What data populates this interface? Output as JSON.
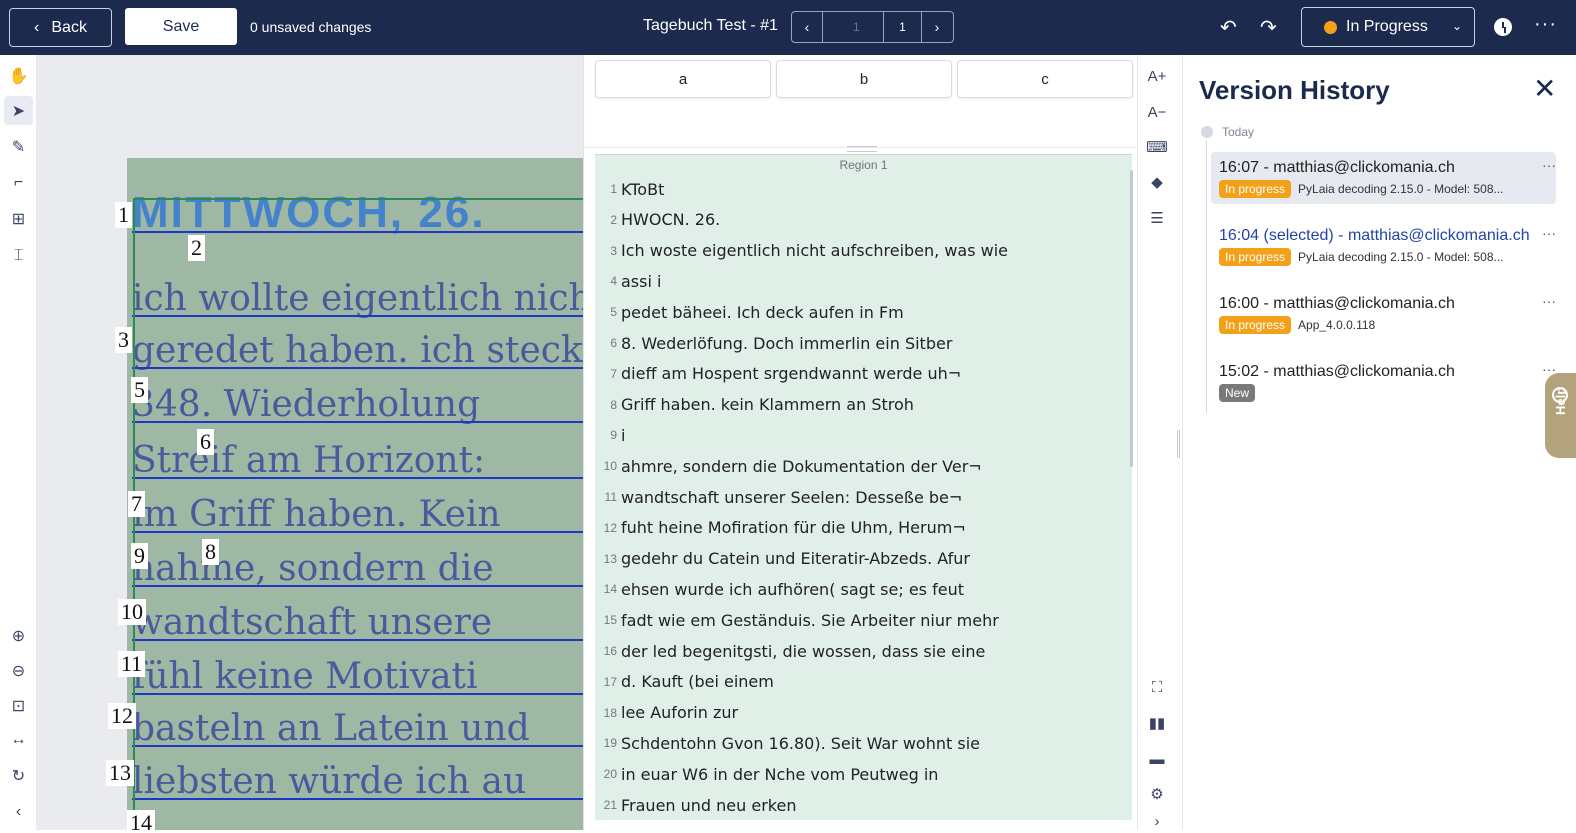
{
  "topbar": {
    "back_label": "Back",
    "save_label": "Save",
    "unsaved": "0 unsaved changes",
    "title": "Tagebuch Test - #1",
    "page_input_placeholder": "1",
    "page_total": "1",
    "status": "In Progress",
    "status_color": "#f4a11a"
  },
  "left_toolbar": {
    "tools": [
      "pan-tool",
      "select-tool",
      "draw-tool",
      "crop-tool",
      "layout-tool",
      "region-tool",
      "zoom-in",
      "zoom-out",
      "fit-screen",
      "fit-width",
      "rotate",
      "collapse"
    ]
  },
  "image": {
    "handwriting": [
      "MITTWOCH, 26.",
      "ich wollte eigentlich nicht",
      "geredet haben. ich steck",
      "348. Wiederholung",
      "Streif am Horizont:",
      "im Griff haben. Kein",
      "nahme, sondern die",
      "wandtschaft unsere",
      "fühl keine Motivati",
      "basteln an Latein und",
      "liebsten würde ich au"
    ],
    "line_numbers": [
      "1",
      "2",
      "3",
      "5",
      "6",
      "7",
      "9",
      "8",
      "10",
      "11",
      "12",
      "13",
      "14"
    ]
  },
  "transcription": {
    "keyboard_keys": [
      "a",
      "b",
      "c"
    ],
    "region_label": "Region 1",
    "lines": [
      {
        "n": "1",
        "text": "KToBt"
      },
      {
        "n": "2",
        "text": "HWOCN. 26."
      },
      {
        "n": "3",
        "text": "Ich woste eigentlich nicht aufschreiben, was wie"
      },
      {
        "n": "4",
        "text": "assi i"
      },
      {
        "n": "5",
        "text": "pedet bäheei. Ich deck aufen in Fm"
      },
      {
        "n": "6",
        "text": "8. Wederlöfung. Doch immerlin ein Sitber"
      },
      {
        "n": "7",
        "text": "dieff am Hospent srgendwannt werde uh¬"
      },
      {
        "n": "8",
        "text": "Griff haben. kein Klammern an Stroh"
      },
      {
        "n": "9",
        "text": "i"
      },
      {
        "n": "10",
        "text": "ahmre, sondern die Dokumentation der Ver¬"
      },
      {
        "n": "11",
        "text": "wandtschaft unserer Seelen: Desseße be¬"
      },
      {
        "n": "12",
        "text": "fuht heine Mofiration für die Uhm, Herum¬"
      },
      {
        "n": "13",
        "text": "gedehr du Catein und Eiteratir-Abzeds. Afur"
      },
      {
        "n": "14",
        "text": "ehsen wurde ich aufhören( sagt se; es feut"
      },
      {
        "n": "15",
        "text": "fadt wie em Geständuis. Sie Arbeiter niur mehr"
      },
      {
        "n": "16",
        "text": "der led begenitgsti, die wossen, dass sie eine"
      },
      {
        "n": "17",
        "text": "d. Kauft (bei einem"
      },
      {
        "n": "18",
        "text": "lee Auforin zur"
      },
      {
        "n": "19",
        "text": "Schdentohn Gvon 16.80). Seit War wohnt sie"
      },
      {
        "n": "20",
        "text": "in euar W6 in der Nche vom Peutweg in"
      },
      {
        "n": "21",
        "text": "Frauen und neu erken"
      }
    ]
  },
  "right_toolbar": {
    "font_increase": "A+",
    "font_decrease": "A−"
  },
  "version_history": {
    "title": "Version History",
    "group_label": "Today",
    "versions": [
      {
        "head": "16:07 - matthias@clickomania.ch",
        "badge": "In progress",
        "model": "PyLaia decoding 2.15.0 - Model: 508..."
      },
      {
        "head": "16:04 (selected) - matthias@clickomania.ch",
        "badge": "In progress",
        "model": "PyLaia decoding 2.15.0 - Model: 508..."
      },
      {
        "head": "16:00 - matthias@clickomania.ch",
        "badge": "In progress",
        "model": "App_4.0.0.118"
      },
      {
        "head": "15:02 - matthias@clickomania.ch",
        "badge": "New",
        "model": ""
      }
    ],
    "help_label": "Help"
  }
}
